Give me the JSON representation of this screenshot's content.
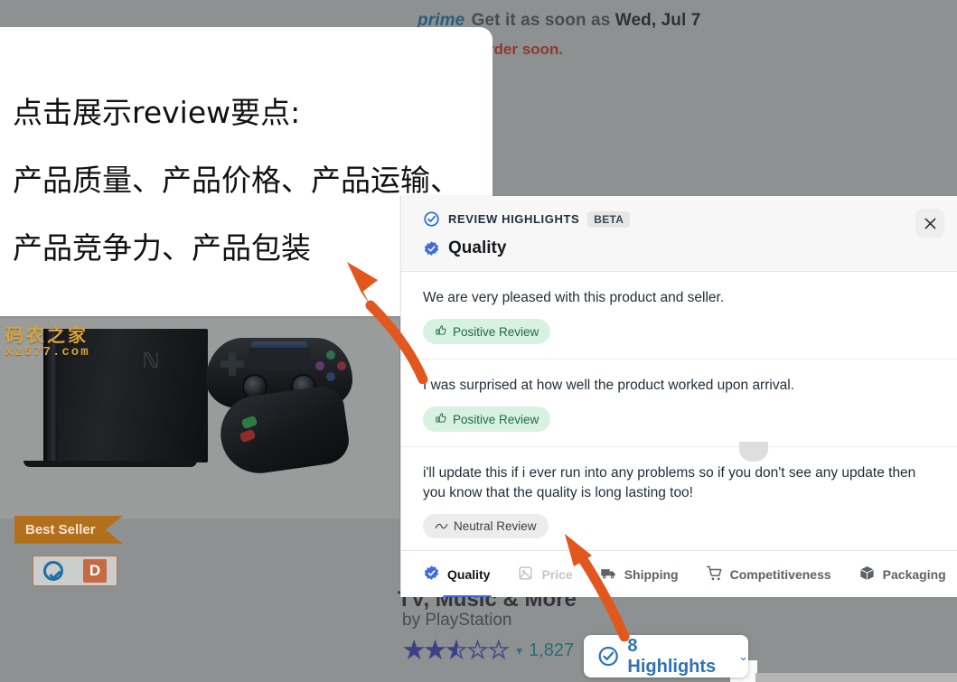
{
  "background": {
    "prime_badge": "prime",
    "delivery_prefix": "Get it as soon as",
    "delivery_date": "Wed, Jul 7",
    "stock_text": "stock - order soon.",
    "product_title_fragment": "TV, Music & More",
    "by_line": "by PlayStation",
    "rating_stars": "2.5",
    "rating_count": "1,827",
    "best_seller_badge": "Best Seller",
    "cert_letter": "D",
    "watermark_cn": "码农之家",
    "watermark_en": "xz577.com"
  },
  "annotation": {
    "line1": "点击展示review要点:",
    "line2": "产品质量、产品价格、产品运输、",
    "line3": "产品竞争力、产品包装"
  },
  "modal": {
    "header_label": "REVIEW HIGHLIGHTS",
    "beta_badge": "BETA",
    "category_title": "Quality",
    "close_label": "✕",
    "reviews": [
      {
        "text": "We are very pleased with this product and seller.",
        "tag": "Positive Review",
        "tag_type": "positive",
        "tag_icon": "thumbs-up"
      },
      {
        "text": "I was surprised at how well the product worked upon arrival.",
        "tag": "Positive Review",
        "tag_type": "positive",
        "tag_icon": "thumbs-up"
      },
      {
        "text": "i'll update this if i ever run into any problems so if you don't see any update then you know that the quality is long lasting too!",
        "tag": "Neutral Review",
        "tag_type": "neutral",
        "tag_icon": "wave"
      }
    ],
    "tabs": [
      {
        "label": "Quality",
        "icon": "verified-badge-icon",
        "state": "active"
      },
      {
        "label": "Price",
        "icon": "price-tag-icon",
        "state": "disabled"
      },
      {
        "label": "Shipping",
        "icon": "truck-icon",
        "state": "normal"
      },
      {
        "label": "Competitiveness",
        "icon": "cart-icon",
        "state": "normal"
      },
      {
        "label": "Packaging",
        "icon": "box-icon",
        "state": "normal"
      }
    ]
  },
  "highlights_button": {
    "label": "8 Highlights",
    "caret": "⌄",
    "icon": "check-circle-icon"
  },
  "colors": {
    "accent_blue": "#2f72b8",
    "tab_active_underline": "#3b6ddb",
    "positive_tag_bg": "#d7f2e0",
    "positive_tag_fg": "#1f6b44",
    "neutral_tag_bg": "#ececec",
    "arrow_orange": "#e2571e",
    "best_seller_bg": "#b3701c",
    "overlay_dim": "#8e9191"
  }
}
